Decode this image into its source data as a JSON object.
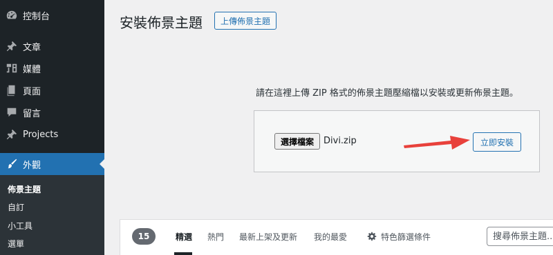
{
  "sidebar": {
    "items": [
      {
        "label": "控制台",
        "icon": "dashboard-icon"
      },
      {
        "label": "文章",
        "icon": "pushpin-icon"
      },
      {
        "label": "媒體",
        "icon": "media-icon"
      },
      {
        "label": "頁面",
        "icon": "pages-icon"
      },
      {
        "label": "留言",
        "icon": "comments-icon"
      },
      {
        "label": "Projects",
        "icon": "pushpin-icon"
      },
      {
        "label": "外觀",
        "icon": "appearance-icon"
      }
    ],
    "submenu": [
      "佈景主題",
      "自訂",
      "小工具",
      "選單"
    ]
  },
  "main": {
    "title": "安裝佈景主題",
    "upload_button": "上傳佈景主題",
    "help_text": "請在這裡上傳 ZIP 格式的佈景主題壓縮檔以安裝或更新佈景主題。",
    "file_button": "選擇檔案",
    "file_name": "Divi.zip",
    "install_button": "立即安裝"
  },
  "filter": {
    "count": "15",
    "tabs": [
      "精選",
      "熱門",
      "最新上架及更新",
      "我的最愛",
      "特色篩選條件"
    ],
    "search_placeholder": "搜尋佈景主題..."
  },
  "colors": {
    "sidebar_bg": "#1d2327",
    "accent": "#2271b1",
    "arrow": "#e8413b"
  }
}
